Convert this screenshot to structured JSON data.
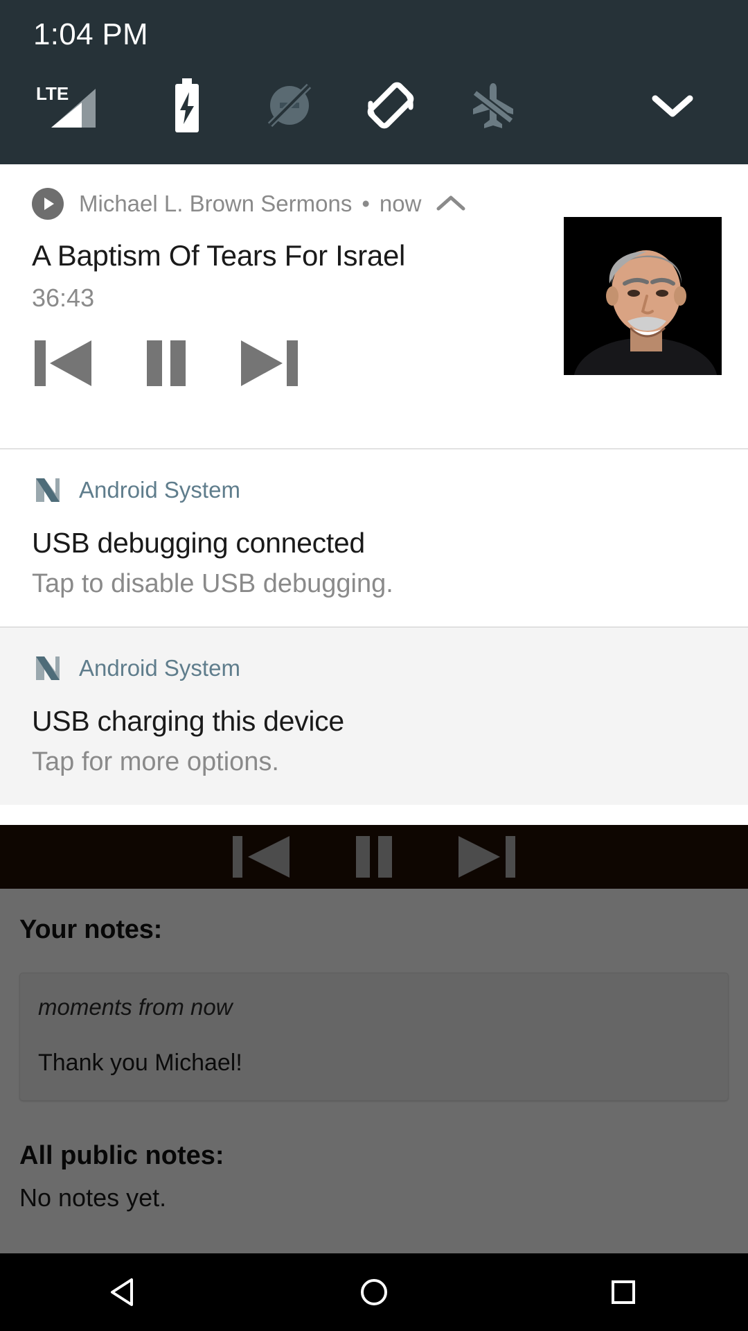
{
  "statusbar": {
    "time": "1:04 PM",
    "quick_settings": [
      {
        "name": "lte-signal-icon",
        "label": "LTE",
        "state": "active"
      },
      {
        "name": "battery-charging-icon",
        "label": "Battery charging",
        "state": "active"
      },
      {
        "name": "do-not-disturb-off-icon",
        "label": "Do not disturb off",
        "state": "inactive"
      },
      {
        "name": "auto-rotate-icon",
        "label": "Auto rotate",
        "state": "active"
      },
      {
        "name": "airplane-mode-off-icon",
        "label": "Airplane mode off",
        "state": "inactive"
      },
      {
        "name": "expand-chevron-icon",
        "label": "Expand quick settings",
        "state": "active"
      }
    ]
  },
  "notifications": {
    "media": {
      "app_name": "Michael L. Brown Sermons",
      "separator": "•",
      "time": "now",
      "title": "A Baptism Of Tears For Israel",
      "duration": "36:43",
      "controls": [
        {
          "name": "previous-track-button",
          "label": "Previous"
        },
        {
          "name": "pause-button",
          "label": "Pause"
        },
        {
          "name": "next-track-button",
          "label": "Next"
        }
      ],
      "album_art_alt": "Speaker portrait"
    },
    "system": [
      {
        "app_name": "Android System",
        "title": "USB debugging connected",
        "body": "Tap to disable USB debugging.",
        "background": "white"
      },
      {
        "app_name": "Android System",
        "title": "USB charging this device",
        "body": "Tap for more options.",
        "background": "gray"
      }
    ]
  },
  "app": {
    "player_controls": [
      {
        "name": "previous-track-button",
        "label": "Previous"
      },
      {
        "name": "pause-button",
        "label": "Pause"
      },
      {
        "name": "next-track-button",
        "label": "Next"
      }
    ],
    "your_notes_heading": "Your notes:",
    "note": {
      "timestamp": "moments from now",
      "text": "Thank you Michael!"
    },
    "public_notes_heading": "All public notes:",
    "public_notes_empty": "No notes yet."
  },
  "navbar": [
    {
      "name": "back-button",
      "label": "Back"
    },
    {
      "name": "home-button",
      "label": "Home"
    },
    {
      "name": "recents-button",
      "label": "Recent apps"
    }
  ],
  "colors": {
    "statusbar_bg": "#263238",
    "accent_system": "#5f7d8c",
    "notif_bg": "#ffffff",
    "notif_alt_bg": "#f4f4f4",
    "player_bar_bg": "#1b0b03"
  }
}
